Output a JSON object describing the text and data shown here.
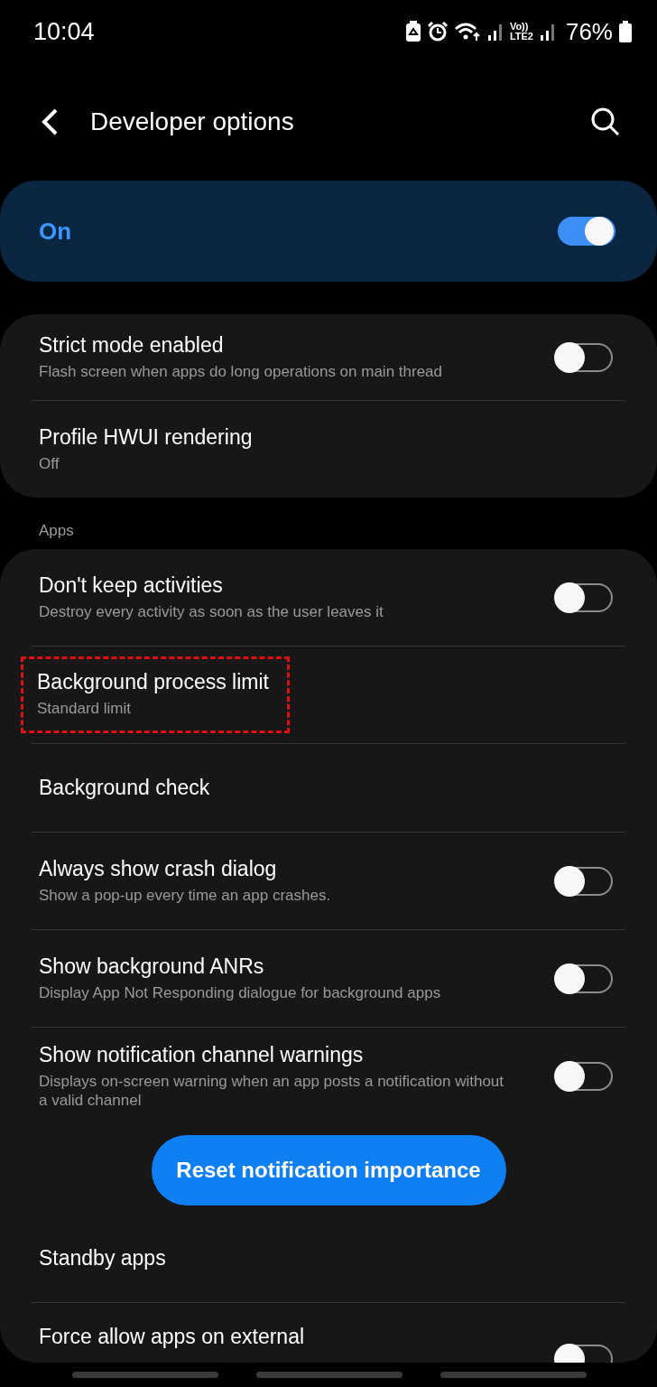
{
  "status_bar": {
    "time": "10:04",
    "network_top": "Vo))",
    "network_bottom": "LTE2",
    "battery": "76%"
  },
  "header": {
    "title": "Developer options"
  },
  "master": {
    "label": "On",
    "on": true
  },
  "group_1": {
    "items": [
      {
        "kind": "switch",
        "title": "Strict mode enabled",
        "subtitle": "Flash screen when apps do long operations on main thread",
        "on": false
      },
      {
        "kind": "link",
        "title": "Profile HWUI rendering",
        "subtitle": "Off"
      }
    ]
  },
  "section_label": "Apps",
  "group_2": {
    "items": [
      {
        "kind": "switch",
        "title": "Don't keep activities",
        "subtitle": "Destroy every activity as soon as the user leaves it",
        "on": false
      },
      {
        "kind": "link",
        "title": "Background process limit",
        "subtitle": "Standard limit",
        "highlighted": true
      },
      {
        "kind": "link",
        "title": "Background check"
      },
      {
        "kind": "switch",
        "title": "Always show crash dialog",
        "subtitle": "Show a pop-up every time an app crashes.",
        "on": false
      },
      {
        "kind": "switch",
        "title": "Show background ANRs",
        "subtitle": "Display App Not Responding dialogue for background apps",
        "on": false
      },
      {
        "kind": "switch",
        "title": "Show notification channel warnings",
        "subtitle": "Displays on-screen warning when an app posts a notification without a valid channel",
        "on": false
      },
      {
        "kind": "button",
        "title": "Reset notification importance"
      },
      {
        "kind": "link",
        "title": "Standby apps"
      },
      {
        "kind": "switch",
        "title": "Force allow apps on external",
        "on": false
      }
    ]
  }
}
